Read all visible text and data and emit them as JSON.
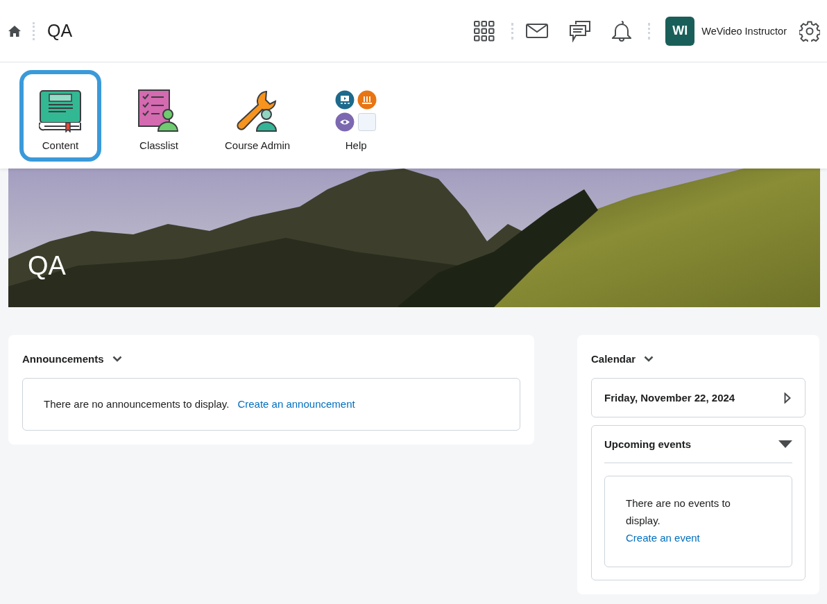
{
  "header": {
    "course_title": "QA",
    "avatar_initials": "WI",
    "user_name": "WeVideo Instructor"
  },
  "nav_tools": [
    {
      "label": "Content",
      "kind": "content",
      "selected": true
    },
    {
      "label": "Classlist",
      "kind": "classlist",
      "selected": false
    },
    {
      "label": "Course Admin",
      "kind": "admin",
      "selected": false
    },
    {
      "label": "Help",
      "kind": "help",
      "selected": false
    }
  ],
  "banner": {
    "title": "QA"
  },
  "announcements": {
    "title": "Announcements",
    "message": "There are no announcements to display.",
    "link": "Create an announcement"
  },
  "calendar": {
    "title": "Calendar",
    "date": "Friday, November 22, 2024",
    "upcoming": {
      "title": "Upcoming events",
      "expanded": true,
      "message": "There are no events to display.",
      "link": "Create an event"
    }
  }
}
